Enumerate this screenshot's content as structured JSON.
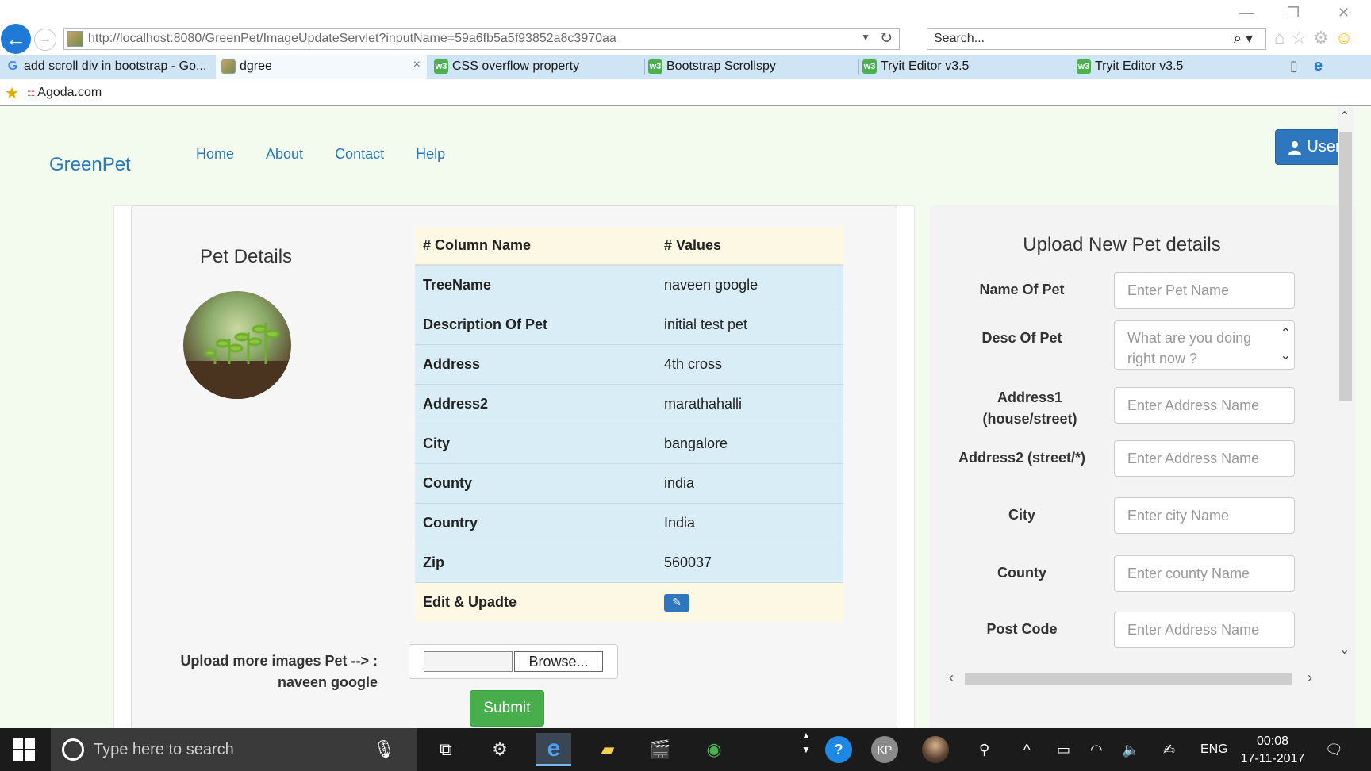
{
  "browser": {
    "url": "http://localhost:8080/GreenPet/ImageUpdateServlet?inputName=59a6fb5a5f93852a8c3970aa",
    "search_placeholder": "Search...",
    "tabs": [
      {
        "label": "add scroll div in bootstrap - Go..."
      },
      {
        "label": "dgree"
      },
      {
        "label": "CSS overflow property"
      },
      {
        "label": "Bootstrap Scrollspy"
      },
      {
        "label": "Tryit Editor v3.5"
      },
      {
        "label": "Tryit Editor v3.5"
      }
    ],
    "favorites": [
      {
        "label": "Agoda.com"
      }
    ]
  },
  "site": {
    "brand": "GreenPet",
    "nav": [
      "Home",
      "About",
      "Contact",
      "Help"
    ],
    "user_label": "User"
  },
  "details": {
    "heading": "Pet Details",
    "columns": [
      "# Column Name",
      "# Values"
    ],
    "rows": [
      {
        "key": "TreeName",
        "value": "naveen google"
      },
      {
        "key": "Description Of Pet",
        "value": "initial test pet"
      },
      {
        "key": "Address",
        "value": "4th cross"
      },
      {
        "key": "Address2",
        "value": "marathahalli"
      },
      {
        "key": "City",
        "value": "bangalore"
      },
      {
        "key": "County",
        "value": "india"
      },
      {
        "key": "Country",
        "value": "India"
      },
      {
        "key": "Zip",
        "value": "560037"
      }
    ],
    "edit_label": "Edit & Upadte",
    "upload_label_line1": "Upload more images Pet --> :",
    "upload_label_line2": "naveen google",
    "browse_label": "Browse...",
    "submit_label": "Submit"
  },
  "form": {
    "title": "Upload New Pet details",
    "fields": [
      {
        "label": "Name Of Pet",
        "placeholder": "Enter Pet Name"
      },
      {
        "label": "Desc Of Pet",
        "placeholder": "What are you doing right now ?"
      },
      {
        "label": "Address1 (house/street)",
        "placeholder": "Enter Address Name"
      },
      {
        "label": "Address2 (street/*)",
        "placeholder": "Enter Address Name"
      },
      {
        "label": "City",
        "placeholder": "Enter city Name"
      },
      {
        "label": "County",
        "placeholder": "Enter county Name"
      },
      {
        "label": "Post Code",
        "placeholder": "Enter Address Name"
      }
    ]
  },
  "taskbar": {
    "search_placeholder": "Type here to search",
    "language": "ENG",
    "time": "00:08",
    "date": "17-11-2017",
    "avatar_initials": "KP"
  },
  "colors": {
    "brand_blue": "#2979b8",
    "button_blue": "#2e76be",
    "submit_green": "#48ad4b",
    "page_bg": "#f2fbee",
    "row_info": "#d9edf7",
    "row_warning": "#fcf8e3"
  }
}
